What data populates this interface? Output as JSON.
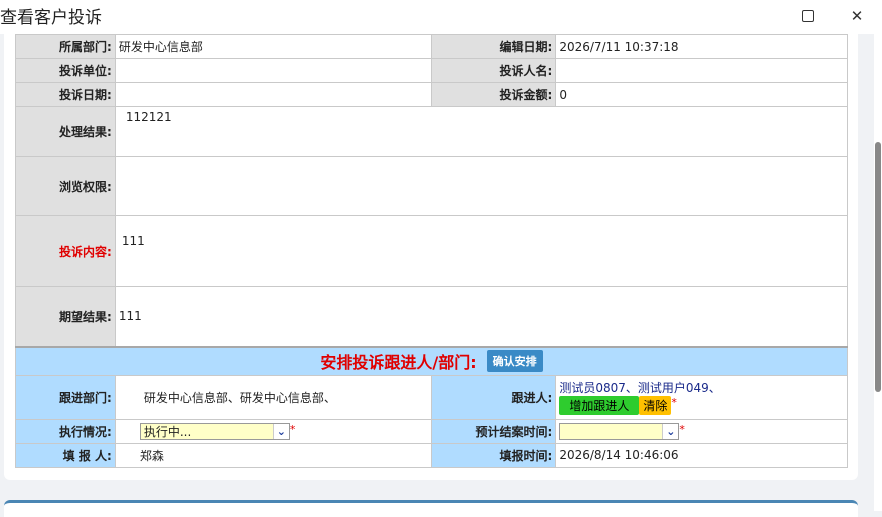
{
  "window": {
    "title": "查看客户投诉"
  },
  "form": {
    "dept_label": "所属部门:",
    "dept_value": "研发中心信息部",
    "edit_date_label": "编辑日期:",
    "edit_date_value": "2026/7/11 10:37:18",
    "unit_label": "投诉单位:",
    "unit_value": "",
    "person_label": "投诉人名:",
    "person_value": "",
    "complaint_date_label": "投诉日期:",
    "complaint_date_value": "",
    "amount_label": "投诉金额:",
    "amount_value": "0",
    "result_label": "处理结果:",
    "result_value": "112121",
    "permission_label": "浏览权限:",
    "permission_value": "",
    "content_label": "投诉内容:",
    "content_value": "111",
    "expected_label": "期望结果:",
    "expected_value": "111"
  },
  "arrange": {
    "title": "安排投诉跟进人/部门:",
    "confirm_button": "确认安排",
    "follow_dept_label": "跟进部门:",
    "follow_dept_value": "研发中心信息部、研发中心信息部、",
    "follower_label": "跟进人:",
    "follower_value": "测试员0807、测试用户049、",
    "add_follower_button": "增加跟进人",
    "clear_button": "清除",
    "status_label": "执行情况:",
    "status_value": "执行中...",
    "close_time_label": "预计结案时间:",
    "close_time_value": "",
    "reporter_label": "填 报 人:",
    "reporter_value": "郑森",
    "report_time_label": "填报时间:",
    "report_time_value": "2026/8/14 10:46:06",
    "required_mark": "*"
  }
}
